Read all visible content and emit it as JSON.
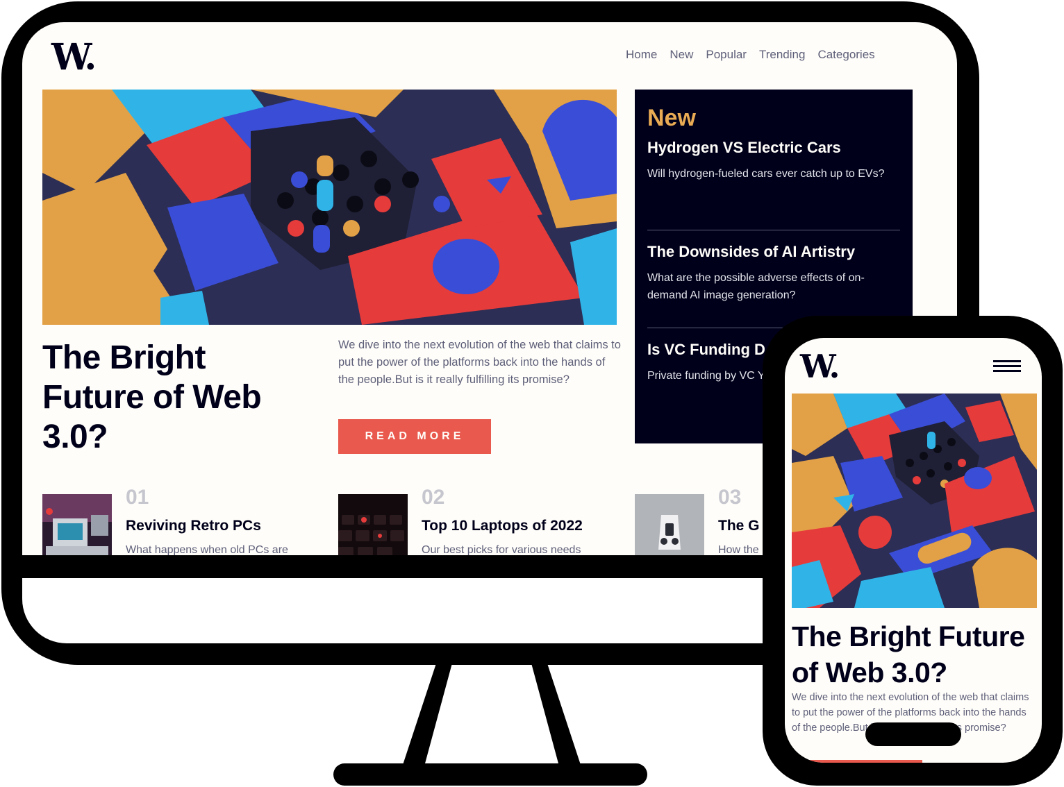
{
  "brand": {
    "logo": "W."
  },
  "nav": {
    "items": [
      {
        "label": "Home"
      },
      {
        "label": "New"
      },
      {
        "label": "Popular"
      },
      {
        "label": "Trending"
      },
      {
        "label": "Categories"
      }
    ]
  },
  "hero": {
    "title": "The Bright Future of Web 3.0?",
    "description": "We dive into the next evolution of the web that claims to put the power of the platforms back into the hands of the people.But is it really fulfilling its promise?",
    "button_label": "READ MORE"
  },
  "new_panel": {
    "title": "New",
    "items": [
      {
        "title": "Hydrogen VS Electric Cars",
        "summary": "Will hydrogen-fueled cars ever catch up to EVs?"
      },
      {
        "title": "The Downsides of AI Artistry",
        "summary": "What are the possible adverse effects of on-demand AI image generation?"
      },
      {
        "title": "Is VC Funding D",
        "summary": "Private funding by VC YOY. We take a look"
      }
    ]
  },
  "articles": [
    {
      "number": "01",
      "title": "Reviving Retro PCs",
      "summary": "What happens when old PCs are"
    },
    {
      "number": "02",
      "title": "Top 10 Laptops of 2022",
      "summary": "Our best picks for various needs"
    },
    {
      "number": "03",
      "title": "The G",
      "summary": "How the"
    }
  ],
  "mobile": {
    "logo": "W.",
    "title": "The Bright Future of Web 3.0?",
    "description": "We dive into the next evolution of the web that claims to put the power of the platforms back into the hands of the people.But is it really fulfilling its promise?"
  },
  "colors": {
    "off_white": "#fffdf9",
    "navy": "#00001a",
    "soft_orange": "#e9ab53",
    "soft_red": "#e9594d",
    "grayish_blue": "#5d5f79"
  }
}
